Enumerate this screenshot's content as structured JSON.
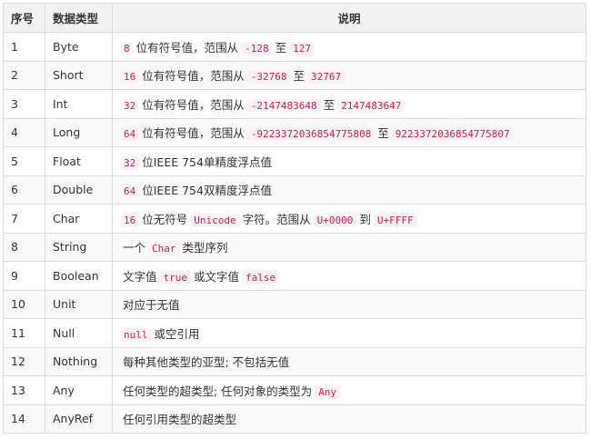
{
  "headers": [
    "序号",
    "数据类型",
    "说明"
  ],
  "rows": [
    {
      "index": "1",
      "type": "Byte",
      "desc": [
        {
          "c": "8"
        },
        {
          "t": "位有符号值，范围从"
        },
        {
          "c": "-128"
        },
        {
          "t": "至"
        },
        {
          "c": "127"
        }
      ]
    },
    {
      "index": "2",
      "type": "Short",
      "desc": [
        {
          "c": "16"
        },
        {
          "t": "位有符号值，范围从"
        },
        {
          "c": "-32768"
        },
        {
          "t": "至"
        },
        {
          "c": "32767"
        }
      ]
    },
    {
      "index": "3",
      "type": "Int",
      "desc": [
        {
          "c": "32"
        },
        {
          "t": "位有符号值，范围从"
        },
        {
          "c": "-2147483648"
        },
        {
          "t": "至"
        },
        {
          "c": "2147483647"
        }
      ]
    },
    {
      "index": "4",
      "type": "Long",
      "desc": [
        {
          "c": "64"
        },
        {
          "t": "位有符号值，范围从"
        },
        {
          "c": "-9223372036854775808"
        },
        {
          "t": "至"
        },
        {
          "c": "9223372036854775807"
        }
      ]
    },
    {
      "index": "5",
      "type": "Float",
      "desc": [
        {
          "c": "32"
        },
        {
          "t": "位IEEE 754单精度浮点值"
        }
      ]
    },
    {
      "index": "6",
      "type": "Double",
      "desc": [
        {
          "c": "64"
        },
        {
          "t": "位IEEE 754双精度浮点值"
        }
      ]
    },
    {
      "index": "7",
      "type": "Char",
      "desc": [
        {
          "c": "16"
        },
        {
          "t": "位无符号"
        },
        {
          "c": "Unicode"
        },
        {
          "t": "字符。范围从"
        },
        {
          "c": "U+0000"
        },
        {
          "t": "到"
        },
        {
          "c": "U+FFFF"
        }
      ]
    },
    {
      "index": "8",
      "type": "String",
      "desc": [
        {
          "t": "一个"
        },
        {
          "c": "Char"
        },
        {
          "t": "类型序列"
        }
      ]
    },
    {
      "index": "9",
      "type": "Boolean",
      "desc": [
        {
          "t": "文字值"
        },
        {
          "c": "true"
        },
        {
          "t": "或文字值"
        },
        {
          "c": "false"
        }
      ]
    },
    {
      "index": "10",
      "type": "Unit",
      "desc": [
        {
          "t": "对应于无值"
        }
      ]
    },
    {
      "index": "11",
      "type": "Null",
      "desc": [
        {
          "c": "null"
        },
        {
          "t": "或空引用"
        }
      ]
    },
    {
      "index": "12",
      "type": "Nothing",
      "desc": [
        {
          "t": "每种其他类型的亚型; 不包括无值"
        }
      ]
    },
    {
      "index": "13",
      "type": "Any",
      "desc": [
        {
          "t": "任何类型的超类型; 任何对象的类型为"
        },
        {
          "c": "Any"
        }
      ]
    },
    {
      "index": "14",
      "type": "AnyRef",
      "desc": [
        {
          "t": "任何引用类型的超类型"
        }
      ]
    }
  ]
}
